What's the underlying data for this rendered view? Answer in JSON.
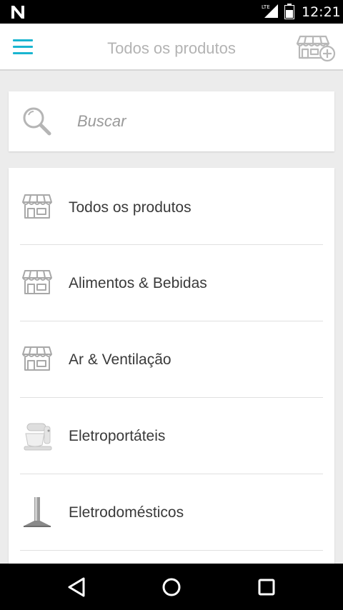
{
  "status_bar": {
    "time": "12:21",
    "network_label": "LTE",
    "icons": [
      "n-notification-icon",
      "lte-signal-icon",
      "battery-icon"
    ]
  },
  "app_bar": {
    "title": "Todos os produtos",
    "accent_color": "#1ab5d0",
    "icons": [
      "hamburger-menu-icon",
      "add-store-icon"
    ]
  },
  "search": {
    "placeholder": "Buscar",
    "icon": "search-icon"
  },
  "categories": [
    {
      "label": "Todos os produtos",
      "icon": "storefront-icon"
    },
    {
      "label": "Alimentos & Bebidas",
      "icon": "storefront-icon"
    },
    {
      "label": "Ar & Ventilação",
      "icon": "storefront-icon"
    },
    {
      "label": "Eletroportáteis",
      "icon": "stand-mixer-image"
    },
    {
      "label": "Eletrodomésticos",
      "icon": "range-hood-image"
    }
  ],
  "nav_bar": {
    "icons": [
      "back-icon",
      "home-icon",
      "recents-icon"
    ]
  }
}
